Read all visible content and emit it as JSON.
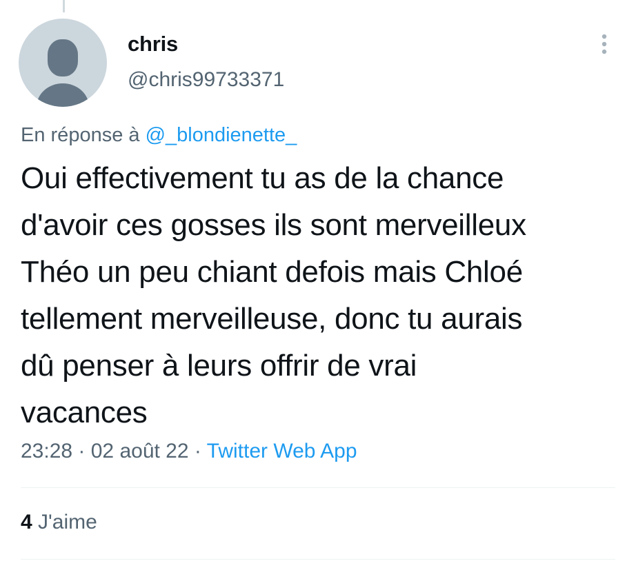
{
  "author": {
    "display_name": "chris",
    "handle": "@chris99733371",
    "avatar_icon": "default-profile-avatar"
  },
  "menu": {
    "more_icon": "vertical-ellipsis-icon"
  },
  "reply": {
    "prefix": "En réponse à ",
    "mention": "@_blondienette_"
  },
  "tweet": {
    "text": "Oui effectivement tu as de la chance\nd'avoir ces gosses ils sont merveilleux\nThéo un peu chiant defois mais Chloé\ntellement merveilleuse, donc tu aurais\ndû penser à leurs offrir de vrai\nvacances",
    "time": "23:28",
    "separator": " · ",
    "date": "02 août 22",
    "source": "Twitter Web App"
  },
  "stats": {
    "likes_count": "4",
    "likes_label": "J'aime"
  },
  "colors": {
    "accent": "#1d9bf0",
    "secondary_text": "#536471",
    "primary_text": "#0f1419",
    "avatar_bg": "#ccd6dd",
    "avatar_figure": "#657786"
  }
}
